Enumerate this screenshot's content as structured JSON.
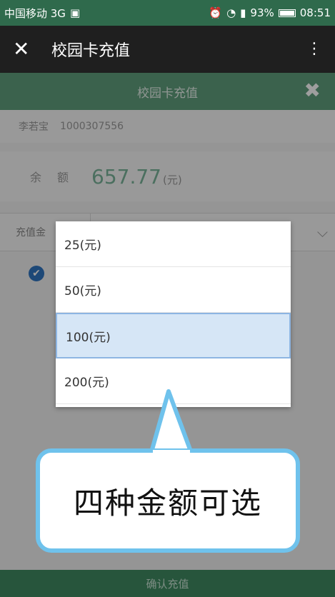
{
  "status_bar": {
    "carrier": "中国移动 3G",
    "battery": "93%",
    "time": "08:51"
  },
  "top_bar": {
    "title": "校园卡充值"
  },
  "page": {
    "header_title": "校园卡充值",
    "user_name": "李若宝",
    "user_id": "1000307556",
    "balance_label": "余额",
    "balance_value": "657.77",
    "balance_unit": "(元)",
    "amount_label": "充值金",
    "confirm_label": "确认充值"
  },
  "dropdown": {
    "options": [
      "25(元)",
      "50(元)",
      "100(元)",
      "200(元)"
    ],
    "selected_index": 2
  },
  "callout": {
    "text": "四种金额可选"
  },
  "colors": {
    "accent_green": "#5f9e7c",
    "callout_border": "#6fc2ec"
  }
}
